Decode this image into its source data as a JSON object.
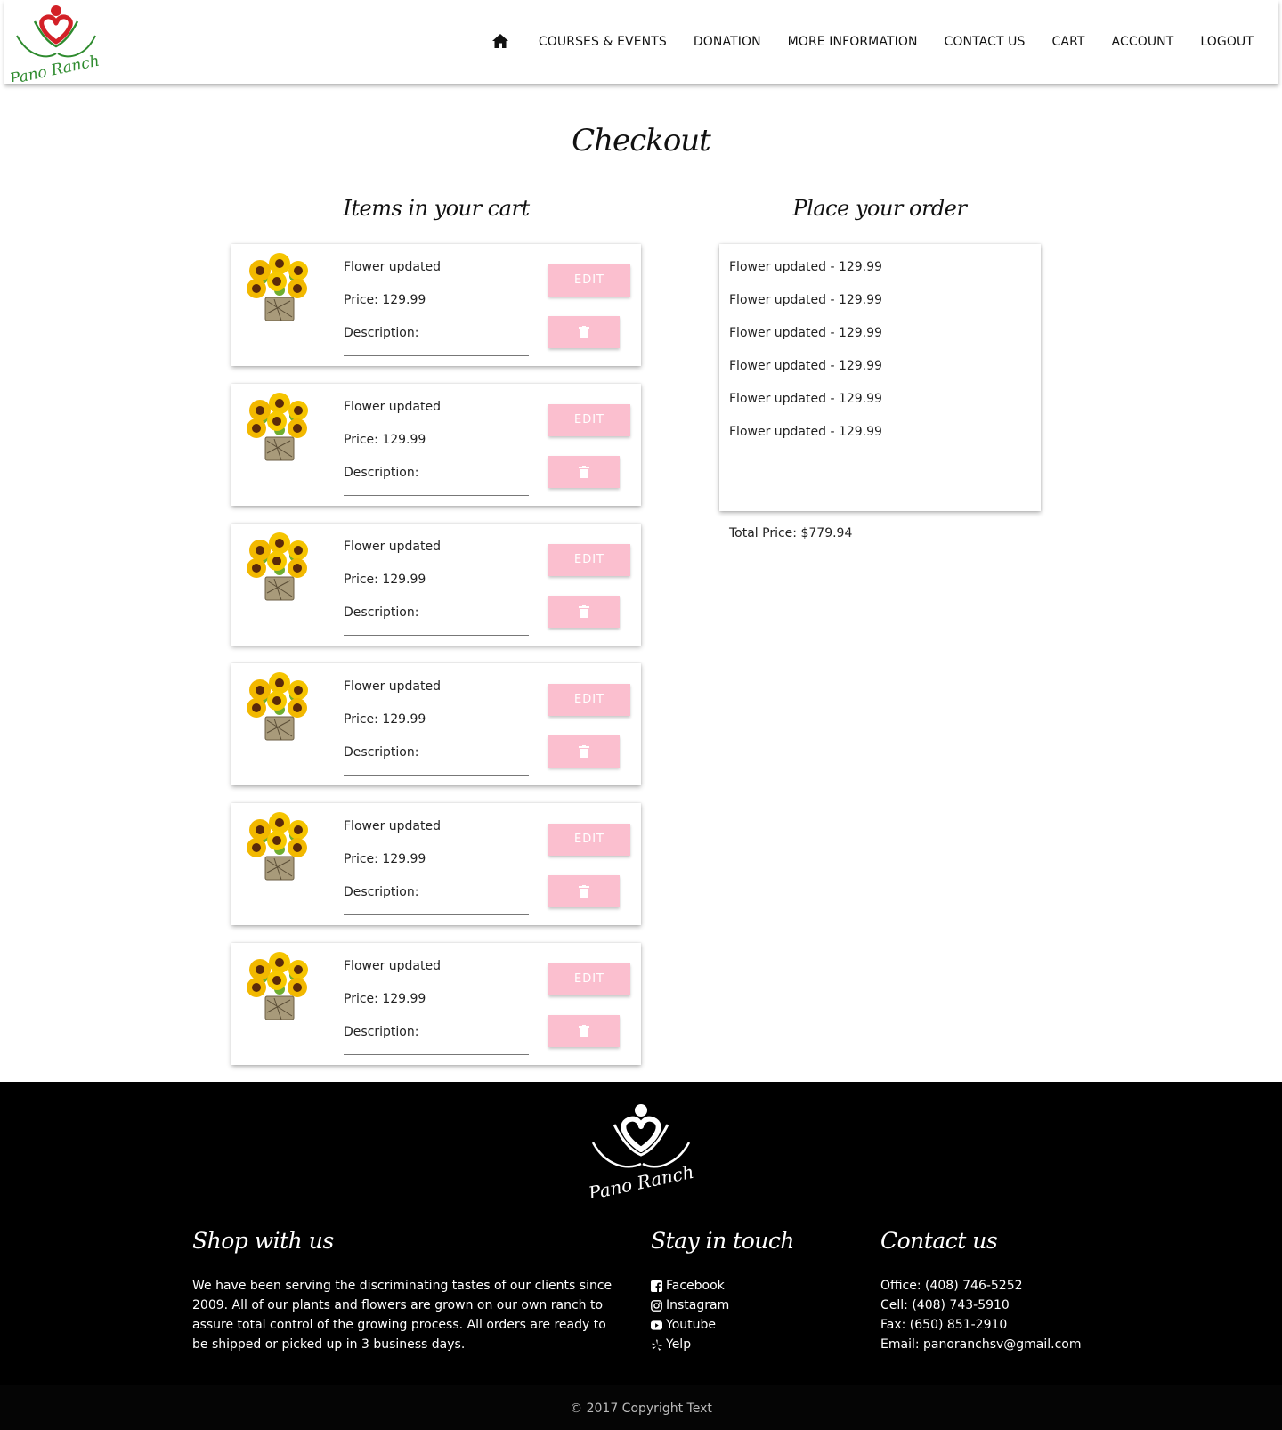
{
  "brand": {
    "name": "Pano Ranch",
    "logo_icon": "heart-person-logo",
    "accent": "#fbbfcf",
    "logo_red": "#d32027",
    "logo_green": "#2e8b2e"
  },
  "nav": {
    "home_icon": "home-icon",
    "items": [
      "COURSES & EVENTS",
      "DONATION",
      "MORE INFORMATION",
      "CONTACT US",
      "CART",
      "ACCOUNT",
      "LOGOUT"
    ]
  },
  "page": {
    "title": "Checkout",
    "cart_heading": "Items in your cart",
    "order_heading": "Place your order"
  },
  "cart": {
    "edit_label": "EDIT",
    "delete_icon": "trash-icon",
    "items": [
      {
        "name": "Flower updated",
        "price": "Price: 129.99",
        "description": "Description:"
      },
      {
        "name": "Flower updated",
        "price": "Price: 129.99",
        "description": "Description:"
      },
      {
        "name": "Flower updated",
        "price": "Price: 129.99",
        "description": "Description:"
      },
      {
        "name": "Flower updated",
        "price": "Price: 129.99",
        "description": "Description:"
      },
      {
        "name": "Flower updated",
        "price": "Price: 129.99",
        "description": "Description:"
      },
      {
        "name": "Flower updated",
        "price": "Price: 129.99",
        "description": "Description:"
      }
    ]
  },
  "order": {
    "lines": [
      "Flower updated - 129.99",
      "Flower updated - 129.99",
      "Flower updated - 129.99",
      "Flower updated - 129.99",
      "Flower updated - 129.99",
      "Flower updated - 129.99"
    ],
    "total": "Total Price: $779.94"
  },
  "footer": {
    "shop_title": "Shop with us",
    "shop_text": "We have been serving the discriminating tastes of our clients since 2009. All of our plants and flowers are grown on our own ranch to assure total control of the growing process. All orders are ready to be shipped or picked up in 3 business days.",
    "touch_title": "Stay in touch",
    "social": [
      {
        "label": "Facebook",
        "icon": "facebook-icon"
      },
      {
        "label": "Instagram",
        "icon": "instagram-icon"
      },
      {
        "label": "Youtube",
        "icon": "youtube-icon"
      },
      {
        "label": "Yelp",
        "icon": "yelp-icon"
      }
    ],
    "contact_title": "Contact us",
    "contact": [
      "Office: (408) 746-5252",
      "Cell: (408) 743-5910",
      "Fax: (650) 851-2910",
      "Email: panoranchsv@gmail.com"
    ],
    "copyright": "© 2017 Copyright Text"
  }
}
